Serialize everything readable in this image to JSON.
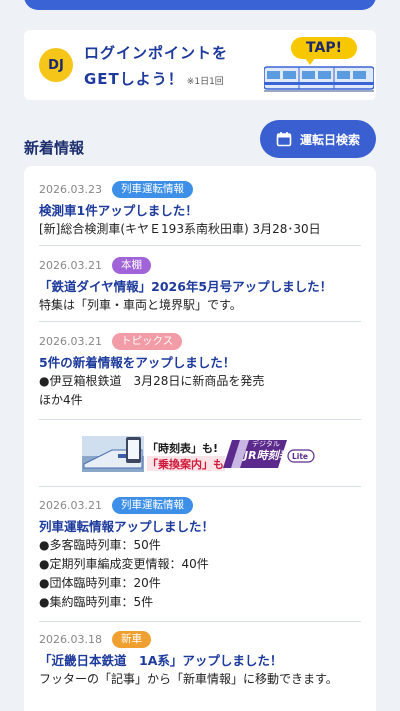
{
  "login_banner": {
    "badge": "DJ",
    "line1": "ログインポイントを",
    "line2": "GETしよう！",
    "note": "※1日1回",
    "tap": "TAP!"
  },
  "news_section": {
    "title": "新着情報",
    "search_button": "運転日検索"
  },
  "news": [
    {
      "date": "2026.03.23",
      "tag": "列車運転情報",
      "tag_color": "#3d8fe8",
      "headline": "検測車1件アップしました！",
      "body": [
        "[新]総合検測車(キヤＥ193系南秋田車) 3月28･30日"
      ]
    },
    {
      "date": "2026.03.21",
      "tag": "本棚",
      "tag_color": "#a064d8",
      "headline": "「鉄道ダイヤ情報」2026年5月号アップしました！",
      "body": [
        "特集は「列車・車両と境界駅」です。"
      ]
    },
    {
      "date": "2026.03.21",
      "tag": "トピックス",
      "tag_color": "#f29ca8",
      "headline": "5件の新着情報をアップしました！",
      "body": [
        "●伊豆箱根鉄道　3月28日に新商品を発売",
        "ほか4件"
      ]
    },
    {
      "date": "2026.03.21",
      "tag": "列車運転情報",
      "tag_color": "#3d8fe8",
      "headline": "列車運転情報アップしました！",
      "body": [
        "●多客臨時列車：50件",
        "●定期列車編成変更情報：40件",
        "●団体臨時列車：20件",
        "●集約臨時列車：5件"
      ]
    },
    {
      "date": "2026.03.18",
      "tag": "新車",
      "tag_color": "#f0a030",
      "headline": "「近畿日本鉄道　1A系」アップしました！",
      "body": [
        "フッターの「記事」から「新車情報」に移動できます。"
      ]
    }
  ],
  "ad_banner": {
    "text1": "「時刻表」も!",
    "text2": "「乗換案内」も!",
    "brand_small": "デジタル",
    "brand": "JR時刻表",
    "brand_tag": "Lite"
  }
}
